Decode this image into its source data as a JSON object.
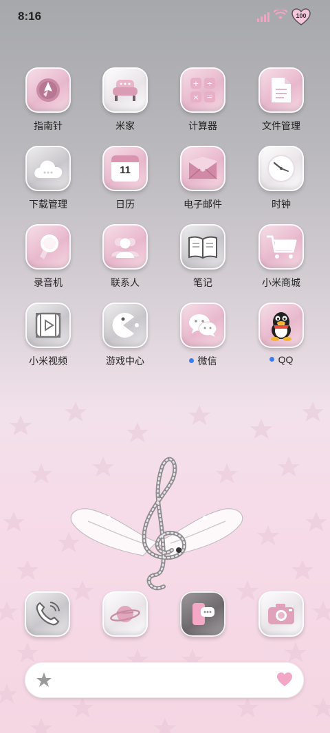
{
  "status_bar": {
    "time": "8:16",
    "battery": "100"
  },
  "apps": [
    {
      "name": "指南针",
      "icon": "compass-icon"
    },
    {
      "name": "米家",
      "icon": "sofa-icon"
    },
    {
      "name": "计算器",
      "icon": "calculator-icon"
    },
    {
      "name": "文件管理",
      "icon": "file-icon"
    },
    {
      "name": "下载管理",
      "icon": "cloud-download-icon"
    },
    {
      "name": "日历",
      "icon": "calendar-icon",
      "badge": "11"
    },
    {
      "name": "电子邮件",
      "icon": "mail-icon"
    },
    {
      "name": "时钟",
      "icon": "clock-icon"
    },
    {
      "name": "录音机",
      "icon": "lightbulb-icon"
    },
    {
      "name": "联系人",
      "icon": "contacts-icon"
    },
    {
      "name": "笔记",
      "icon": "book-icon"
    },
    {
      "name": "小米商城",
      "icon": "cart-icon"
    },
    {
      "name": "小米视频",
      "icon": "video-icon"
    },
    {
      "name": "游戏中心",
      "icon": "pacman-icon"
    },
    {
      "name": "微信",
      "icon": "wechat-icon",
      "new": true
    },
    {
      "name": "QQ",
      "icon": "qq-penguin-icon",
      "new": true
    }
  ],
  "dock": [
    {
      "icon": "phone-icon"
    },
    {
      "icon": "planet-icon"
    },
    {
      "icon": "message-icon"
    },
    {
      "icon": "camera-icon"
    }
  ],
  "colors": {
    "accent_pink": "#e6a9c2",
    "dot_blue": "#3a7bf2"
  }
}
